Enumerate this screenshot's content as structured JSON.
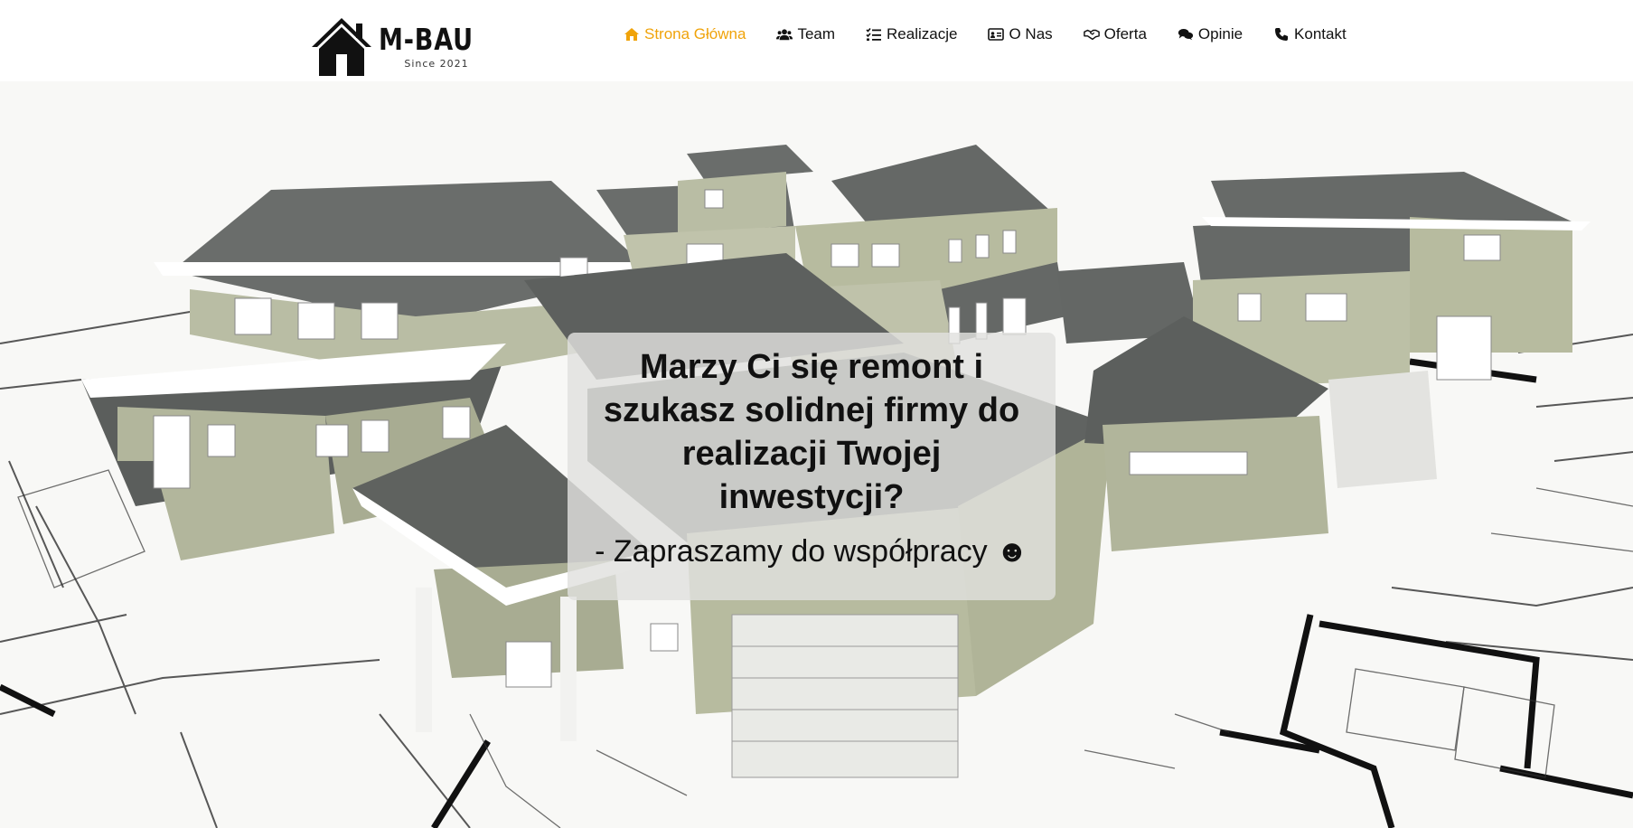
{
  "logo": {
    "name": "M-BAU",
    "since": "Since 2021"
  },
  "nav": {
    "items": [
      {
        "label": "Strona Główna",
        "icon": "home-icon",
        "active": true
      },
      {
        "label": "Team",
        "icon": "users-icon",
        "active": false
      },
      {
        "label": "Realizacje",
        "icon": "list-check-icon",
        "active": false
      },
      {
        "label": "O Nas",
        "icon": "id-card-icon",
        "active": false
      },
      {
        "label": "Oferta",
        "icon": "handshake-icon",
        "active": false
      },
      {
        "label": "Opinie",
        "icon": "comments-icon",
        "active": false
      },
      {
        "label": "Kontakt",
        "icon": "phone-icon",
        "active": false
      }
    ],
    "active_color": "#f0a30a",
    "text_color": "#111111"
  },
  "hero": {
    "title": "Marzy Ci się remont i szukasz solidnej firmy do realizacji Twojej inwestycji?",
    "subtitle": "- Zapraszamy do współpracy ☻",
    "image": "houses-on-blueprints"
  }
}
